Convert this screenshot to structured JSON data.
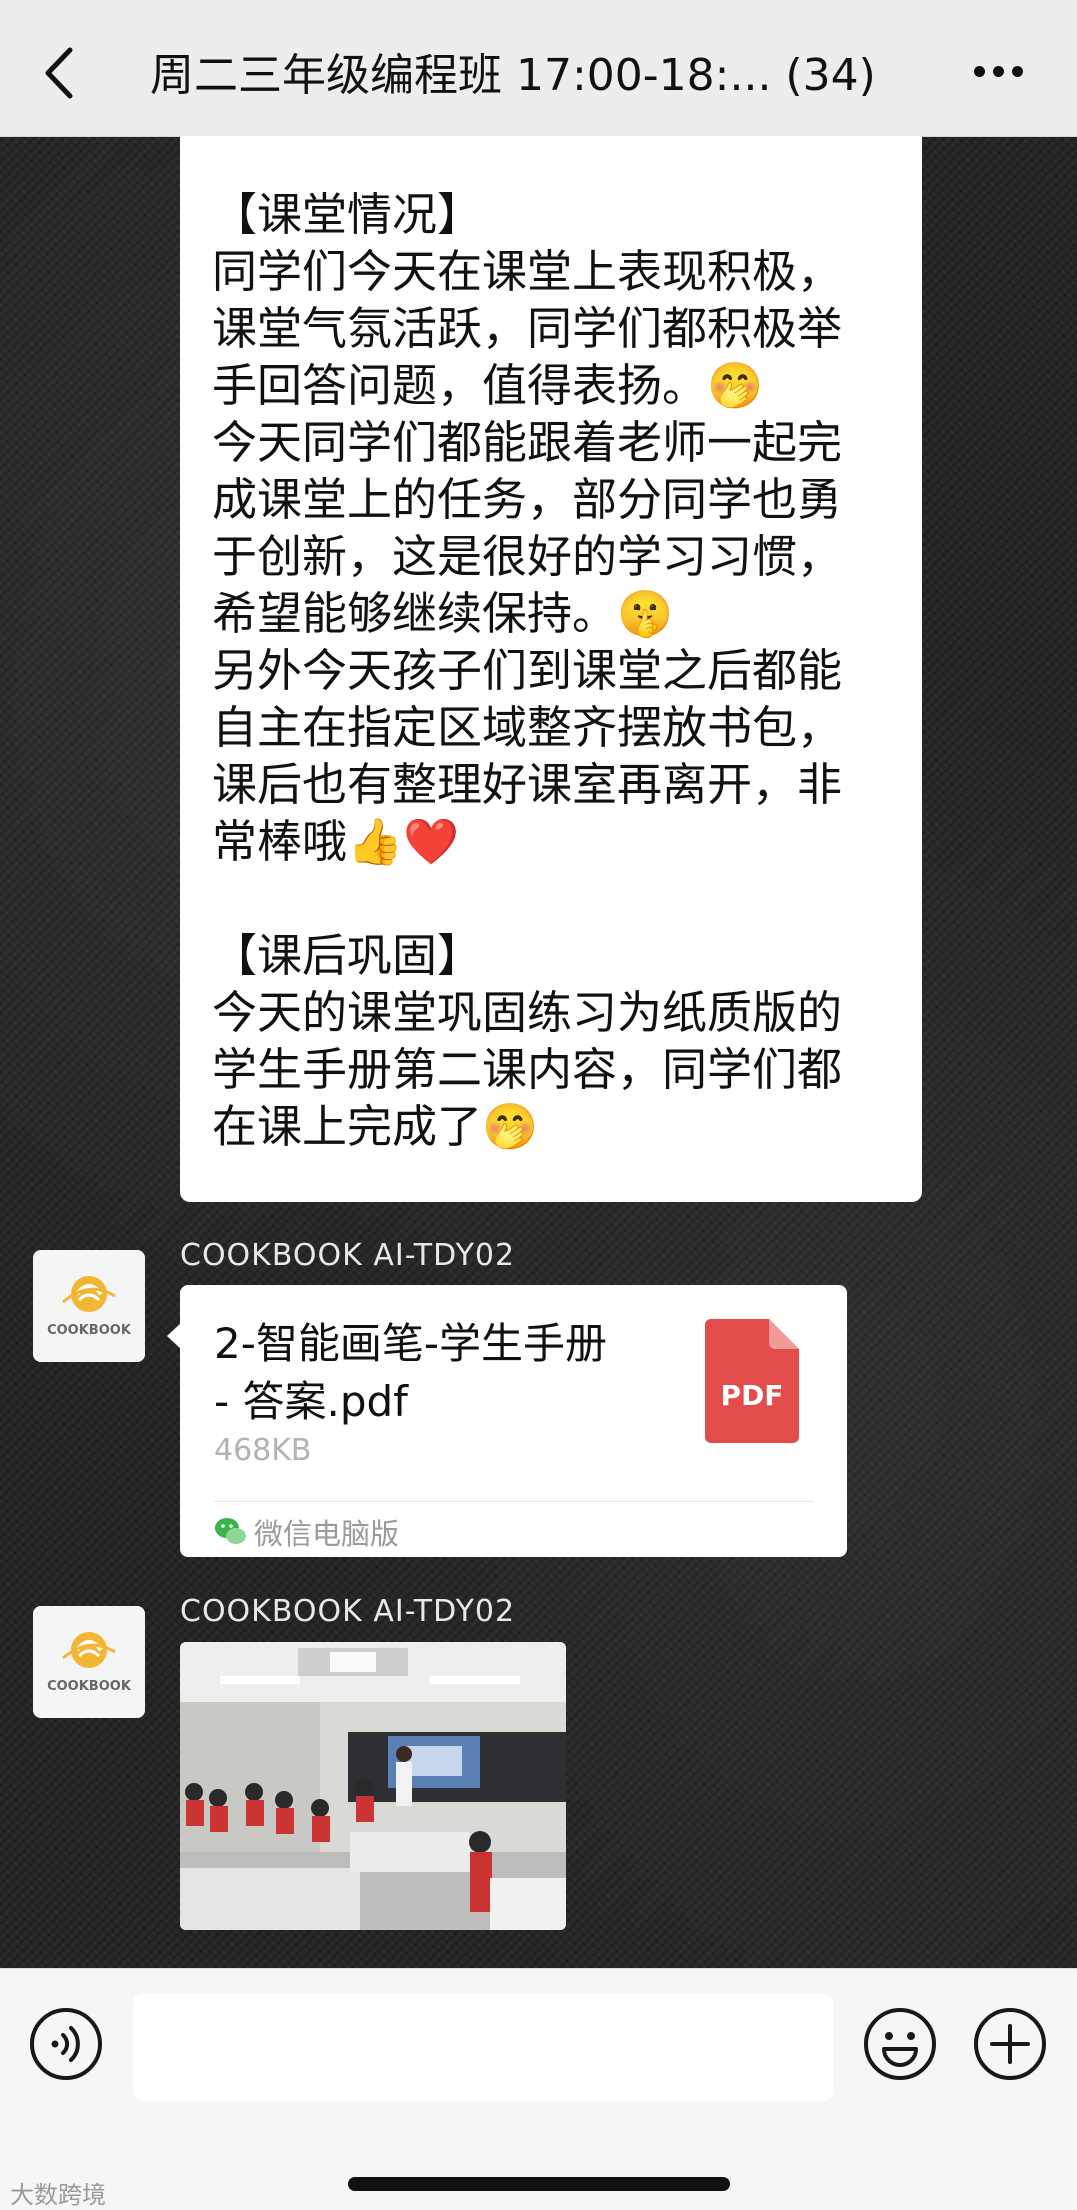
{
  "header": {
    "title": "周二三年级编程班 17:00-18:... (34)",
    "back_icon": "chevron-left-icon",
    "more_icon": "more-dots-icon"
  },
  "messages": {
    "text_message": {
      "content": "【课堂情况】\n同学们今天在课堂上表现积极，\n课堂气氛活跃，同学们都积极举\n手回答问题，值得表扬。🤭\n今天同学们都能跟着老师一起完\n成课堂上的任务，部分同学也勇\n于创新，这是很好的学习习惯，\n希望能够继续保持。🤫\n另外今天孩子们到课堂之后都能\n自主在指定区域整齐摆放书包，\n课后也有整理好课室再离开，非\n常棒哦👍❤️\n\n【课后巩固】\n今天的课堂巩固练习为纸质版的\n学生手册第二课内容，同学们都\n在课上完成了🤭"
    },
    "file_message": {
      "sender": "COOKBOOK AI-TDY02",
      "file_name": "2-智能画笔-学生手册 - 答案.pdf",
      "file_size": "468KB",
      "file_type_label": "PDF",
      "source": "微信电脑版"
    },
    "image_message": {
      "sender": "COOKBOOK AI-TDY02"
    },
    "avatar_label": "COOKBOOK"
  },
  "input_bar": {
    "value": "",
    "voice_icon": "voice-icon",
    "emoji_icon": "emoji-icon",
    "plus_icon": "plus-icon"
  },
  "watermark": "大数跨境"
}
